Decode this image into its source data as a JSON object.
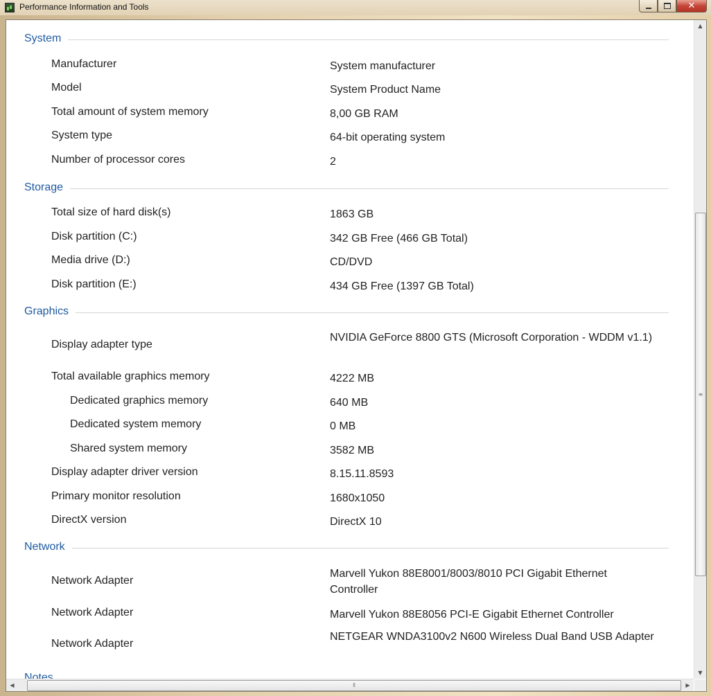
{
  "window": {
    "title": "Performance Information and Tools"
  },
  "sections": {
    "system": {
      "title": "System",
      "rows": [
        {
          "label": "Manufacturer",
          "value": "System manufacturer"
        },
        {
          "label": "Model",
          "value": "System Product Name"
        },
        {
          "label": "Total amount of system memory",
          "value": "8,00 GB RAM"
        },
        {
          "label": "System type",
          "value": "64-bit operating system"
        },
        {
          "label": "Number of processor cores",
          "value": "2"
        }
      ]
    },
    "storage": {
      "title": "Storage",
      "rows": [
        {
          "label": "Total size of hard disk(s)",
          "value": "1863 GB"
        },
        {
          "label": "Disk partition (C:)",
          "value": "342 GB Free (466 GB Total)"
        },
        {
          "label": "Media drive (D:)",
          "value": "CD/DVD"
        },
        {
          "label": "Disk partition (E:)",
          "value": "434 GB Free (1397 GB Total)"
        }
      ]
    },
    "graphics": {
      "title": "Graphics",
      "rows": [
        {
          "label": "Display adapter type",
          "value": "NVIDIA GeForce 8800 GTS (Microsoft Corporation - WDDM v1.1)"
        },
        {
          "label": "Total available graphics memory",
          "value": "4222 MB"
        },
        {
          "label": "Dedicated graphics memory",
          "value": "640 MB"
        },
        {
          "label": "Dedicated system memory",
          "value": "0 MB"
        },
        {
          "label": "Shared system memory",
          "value": "3582 MB"
        },
        {
          "label": "Display adapter driver version",
          "value": "8.15.11.8593"
        },
        {
          "label": "Primary monitor resolution",
          "value": "1680x1050"
        },
        {
          "label": "DirectX version",
          "value": "DirectX 10"
        }
      ]
    },
    "network": {
      "title": "Network",
      "rows": [
        {
          "label": "Network Adapter",
          "value": "Marvell Yukon 88E8001/8003/8010 PCI Gigabit Ethernet Controller"
        },
        {
          "label": "Network Adapter",
          "value": "Marvell Yukon 88E8056 PCI-E Gigabit Ethernet Controller"
        },
        {
          "label": "Network Adapter",
          "value": "NETGEAR WNDA3100v2 N600 Wireless Dual Band USB Adapter"
        }
      ]
    },
    "notes": {
      "title": "Notes"
    }
  }
}
